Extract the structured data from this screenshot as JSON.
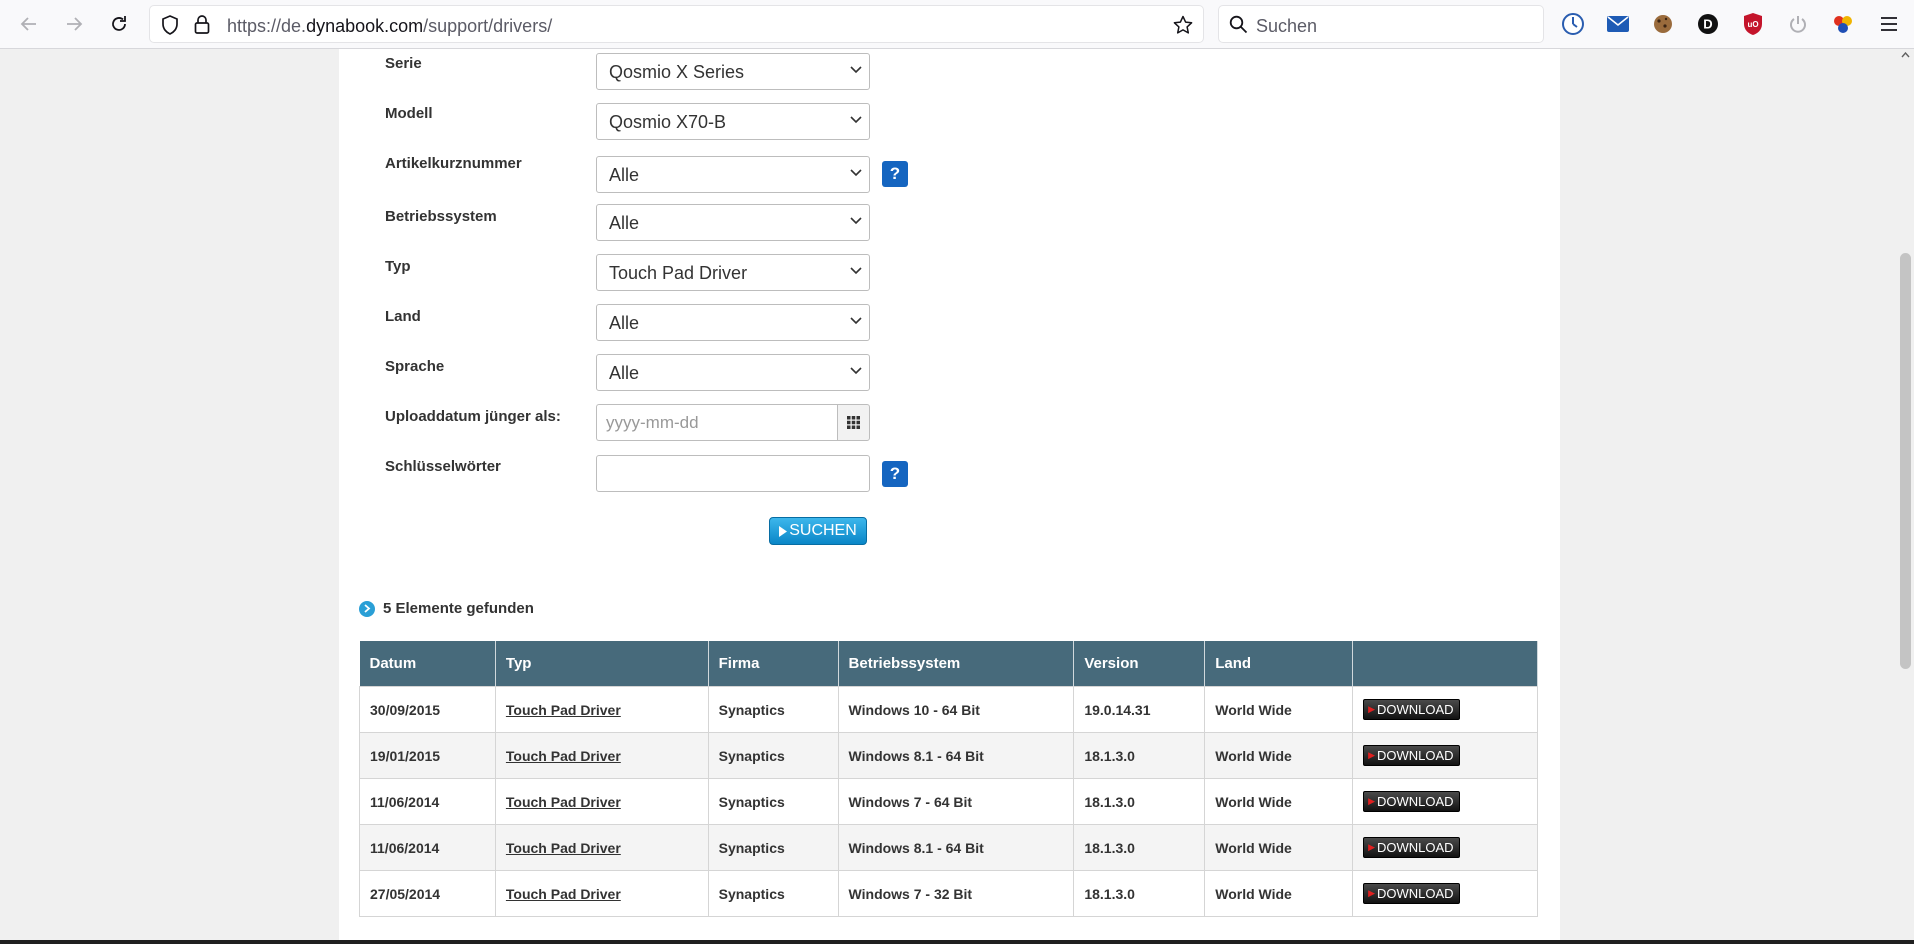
{
  "browser": {
    "url_prefix": "https://de.",
    "url_host": "dynabook.com",
    "url_path": "/support/drivers/",
    "search_placeholder": "Suchen"
  },
  "form": {
    "serie": {
      "label": "Serie",
      "value": "Qosmio X Series"
    },
    "modell": {
      "label": "Modell",
      "value": "Qosmio X70-B"
    },
    "artikel": {
      "label": "Artikelkurznummer",
      "value": "Alle"
    },
    "betriebssystem": {
      "label": "Betriebssystem",
      "value": "Alle"
    },
    "typ": {
      "label": "Typ",
      "value": "Touch Pad Driver"
    },
    "land": {
      "label": "Land",
      "value": "Alle"
    },
    "sprache": {
      "label": "Sprache",
      "value": "Alle"
    },
    "upload": {
      "label": "Uploaddatum jünger als:",
      "placeholder": "yyyy-mm-dd"
    },
    "keywords": {
      "label": "Schlüsselwörter",
      "value": ""
    },
    "help_label": "?",
    "search_label": "SUCHEN"
  },
  "results": {
    "heading": "5 Elemente gefunden",
    "columns": [
      "Datum",
      "Typ",
      "Firma",
      "Betriebssystem",
      "Version",
      "Land",
      ""
    ],
    "download_label": "DOWNLOAD",
    "rows": [
      {
        "datum": "30/09/2015",
        "typ": "Touch Pad Driver",
        "firma": "Synaptics",
        "os": "Windows 10 - 64 Bit",
        "version": "19.0.14.31",
        "land": "World Wide"
      },
      {
        "datum": "19/01/2015",
        "typ": "Touch Pad Driver",
        "firma": "Synaptics",
        "os": "Windows 8.1 - 64 Bit",
        "version": "18.1.3.0",
        "land": "World Wide"
      },
      {
        "datum": "11/06/2014",
        "typ": "Touch Pad Driver",
        "firma": "Synaptics",
        "os": "Windows 7 - 64 Bit",
        "version": "18.1.3.0",
        "land": "World Wide"
      },
      {
        "datum": "11/06/2014",
        "typ": "Touch Pad Driver",
        "firma": "Synaptics",
        "os": "Windows 8.1 - 64 Bit",
        "version": "18.1.3.0",
        "land": "World Wide"
      },
      {
        "datum": "27/05/2014",
        "typ": "Touch Pad Driver",
        "firma": "Synaptics",
        "os": "Windows 7 - 32 Bit",
        "version": "18.1.3.0",
        "land": "World Wide"
      }
    ]
  },
  "colors": {
    "table_header": "#476a7b",
    "help_button": "#1565c0",
    "search_button": "#1a9ad8"
  }
}
